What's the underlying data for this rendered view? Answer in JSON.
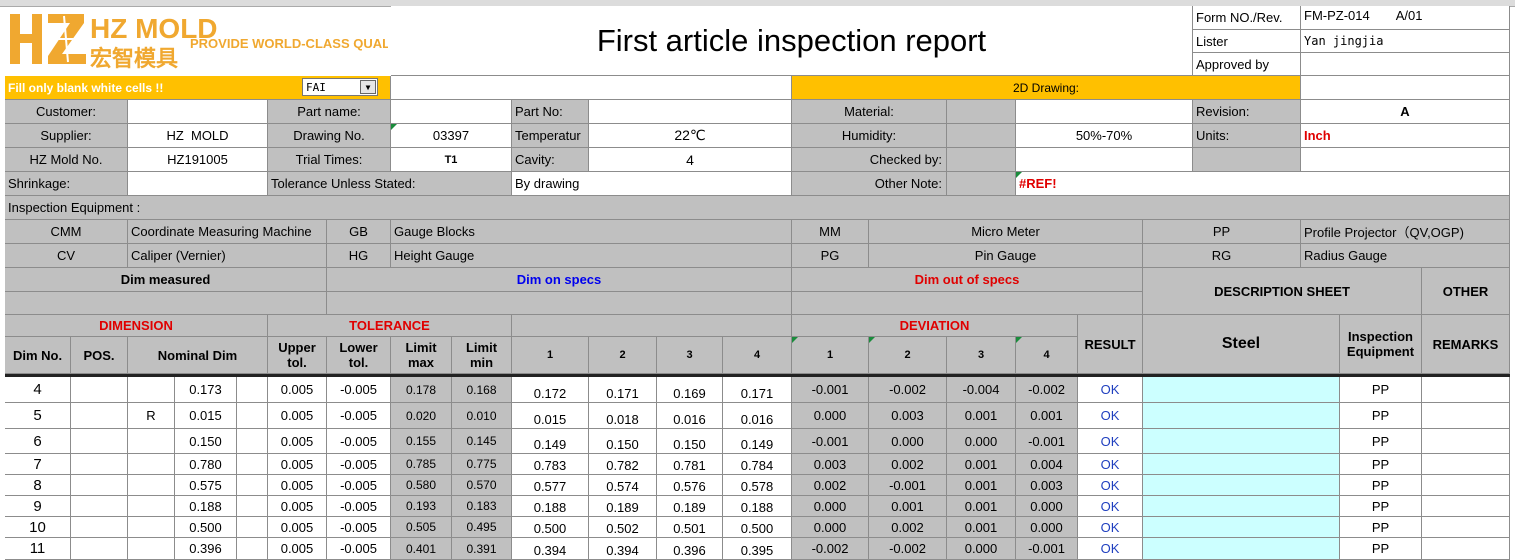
{
  "logo": {
    "brand": "HZ MOLD",
    "chinese": "宏智模具",
    "tagline": "PROVIDE WORLD-CLASS QUALITY"
  },
  "title": "First article inspection report",
  "form": {
    "form_no_label": "Form NO./Rev.",
    "form_no": "FM-PZ-014",
    "rev": "A/01",
    "lister_label": "Lister",
    "lister": "Yan jingjia",
    "approved_label": "Approved by",
    "approved": ""
  },
  "notice": "Fill only blank white cells !!",
  "type_select": "FAI",
  "drawing_2d": "2D Drawing:",
  "info": {
    "customer_label": "Customer:",
    "customer": "",
    "part_name_label": "Part name:",
    "part_name": "",
    "part_no_label": "Part No:",
    "part_no": "",
    "material_label": "Material:",
    "material": "",
    "revision_label": "Revision:",
    "revision": "A",
    "supplier_label": "Supplier:",
    "supplier": "HZ  MOLD",
    "drawing_no_label": "Drawing No.",
    "drawing_no": "03397",
    "temperature_label": "Temperatur",
    "temperature": "22℃",
    "humidity_label": "Humidity:",
    "humidity": "50%-70%",
    "units_label": "Units:",
    "units": "Inch",
    "mold_no_label": "HZ Mold No.",
    "mold_no": "HZ191005",
    "trial_label": "Trial Times:",
    "trial": "T1",
    "cavity_label": "Cavity:",
    "cavity": "4",
    "checked_label": "Checked by:",
    "shrinkage_label": "Shrinkage:",
    "tolerance_label": "Tolerance Unless Stated:",
    "tolerance": "By drawing",
    "other_note_label": "Other Note:",
    "other_note": "#REF!"
  },
  "equipment": {
    "label": "Inspection Equipment :",
    "items": [
      {
        "code": "CMM",
        "name": "Coordinate Measuring Machine"
      },
      {
        "code": "GB",
        "name": "Gauge Blocks"
      },
      {
        "code": "MM",
        "name": "Micro Meter"
      },
      {
        "code": "PP",
        "name": "Profile Projector（QV,OGP)"
      },
      {
        "code": "CV",
        "name": "Caliper (Vernier)"
      },
      {
        "code": "HG",
        "name": "Height Gauge"
      },
      {
        "code": "PG",
        "name": "Pin Gauge"
      },
      {
        "code": "RG",
        "name": "Radius Gauge"
      }
    ]
  },
  "legend": {
    "measured": "Dim measured",
    "on_specs": "Dim on specs",
    "out_specs": "Dim out of specs",
    "description": "DESCRIPTION  SHEET",
    "other": "OTHER"
  },
  "headers": {
    "dimension": "DIMENSION",
    "tolerance": "TOLERANCE",
    "deviation": "DEVIATION",
    "result": "RESULT",
    "steel": "Steel",
    "inspection_equipment": "Inspection Equipment",
    "remarks": "REMARKS",
    "dim_no": "Dim No.",
    "pos": "POS.",
    "nominal": "Nominal Dim",
    "upper": "Upper tol.",
    "lower": "Lower tol.",
    "lmax": "Limit max",
    "lmin": "Limit min",
    "c1": "1",
    "c2": "2",
    "c3": "3",
    "c4": "4",
    "d1": "1",
    "d2": "2",
    "d3": "3",
    "d4": "4"
  },
  "rows": [
    {
      "no": "4",
      "pos": "",
      "sym": "",
      "nom": "0.173",
      "up": "0.005",
      "lo": "-0.005",
      "max": "0.178",
      "min": "0.168",
      "m": [
        "0.172",
        "0.171",
        "0.169",
        "0.171"
      ],
      "d": [
        "-0.001",
        "-0.002",
        "-0.004",
        "-0.002"
      ],
      "res": "OK",
      "eq": "PP"
    },
    {
      "no": "5",
      "pos": "",
      "sym": "R",
      "nom": "0.015",
      "up": "0.005",
      "lo": "-0.005",
      "max": "0.020",
      "min": "0.010",
      "m": [
        "0.015",
        "0.018",
        "0.016",
        "0.016"
      ],
      "d": [
        "0.000",
        "0.003",
        "0.001",
        "0.001"
      ],
      "res": "OK",
      "eq": "PP"
    },
    {
      "no": "6",
      "pos": "",
      "sym": "",
      "nom": "0.150",
      "up": "0.005",
      "lo": "-0.005",
      "max": "0.155",
      "min": "0.145",
      "m": [
        "0.149",
        "0.150",
        "0.150",
        "0.149"
      ],
      "d": [
        "-0.001",
        "0.000",
        "0.000",
        "-0.001"
      ],
      "res": "OK",
      "eq": "PP"
    },
    {
      "no": "7",
      "pos": "",
      "sym": "",
      "nom": "0.780",
      "up": "0.005",
      "lo": "-0.005",
      "max": "0.785",
      "min": "0.775",
      "m": [
        "0.783",
        "0.782",
        "0.781",
        "0.784"
      ],
      "d": [
        "0.003",
        "0.002",
        "0.001",
        "0.004"
      ],
      "res": "OK",
      "eq": "PP"
    },
    {
      "no": "8",
      "pos": "",
      "sym": "",
      "nom": "0.575",
      "up": "0.005",
      "lo": "-0.005",
      "max": "0.580",
      "min": "0.570",
      "m": [
        "0.577",
        "0.574",
        "0.576",
        "0.578"
      ],
      "d": [
        "0.002",
        "-0.001",
        "0.001",
        "0.003"
      ],
      "res": "OK",
      "eq": "PP"
    },
    {
      "no": "9",
      "pos": "",
      "sym": "",
      "nom": "0.188",
      "up": "0.005",
      "lo": "-0.005",
      "max": "0.193",
      "min": "0.183",
      "m": [
        "0.188",
        "0.189",
        "0.189",
        "0.188"
      ],
      "d": [
        "0.000",
        "0.001",
        "0.001",
        "0.000"
      ],
      "res": "OK",
      "eq": "PP"
    },
    {
      "no": "10",
      "pos": "",
      "sym": "",
      "nom": "0.500",
      "up": "0.005",
      "lo": "-0.005",
      "max": "0.505",
      "min": "0.495",
      "m": [
        "0.500",
        "0.502",
        "0.501",
        "0.500"
      ],
      "d": [
        "0.000",
        "0.002",
        "0.001",
        "0.000"
      ],
      "res": "OK",
      "eq": "PP"
    },
    {
      "no": "11",
      "pos": "",
      "sym": "",
      "nom": "0.396",
      "up": "0.005",
      "lo": "-0.005",
      "max": "0.401",
      "min": "0.391",
      "m": [
        "0.394",
        "0.394",
        "0.396",
        "0.395"
      ],
      "d": [
        "-0.002",
        "-0.002",
        "0.000",
        "-0.001"
      ],
      "res": "OK",
      "eq": "PP"
    }
  ]
}
